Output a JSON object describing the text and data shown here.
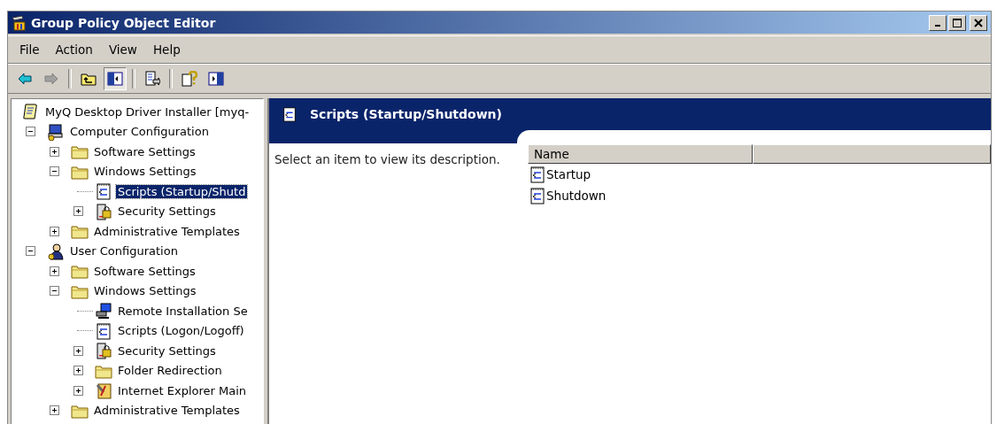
{
  "window": {
    "title": "Group Policy Object Editor"
  },
  "menu": [
    "File",
    "Action",
    "View",
    "Help"
  ],
  "toolbar": [
    {
      "kind": "back",
      "pressed": false
    },
    {
      "kind": "forward",
      "pressed": false
    },
    {
      "kind": "sep"
    },
    {
      "kind": "up",
      "pressed": false
    },
    {
      "kind": "tree",
      "pressed": true
    },
    {
      "kind": "sep"
    },
    {
      "kind": "export",
      "pressed": false
    },
    {
      "kind": "sep"
    },
    {
      "kind": "help",
      "pressed": false
    },
    {
      "kind": "pane",
      "pressed": false
    }
  ],
  "tree": [
    {
      "label": "MyQ Desktop Driver Installer [myq-",
      "kind": "policy",
      "selected": false,
      "children": [
        {
          "label": "Computer Configuration",
          "kind": "computer",
          "expanded": true,
          "selected": false,
          "children": [
            {
              "label": "Software Settings",
              "kind": "folder",
              "expanded": false,
              "selected": false
            },
            {
              "label": "Windows Settings",
              "kind": "folder",
              "expanded": true,
              "selected": false,
              "children": [
                {
                  "label": "Scripts (Startup/Shutd",
                  "kind": "script",
                  "selected": true
                },
                {
                  "label": "Security Settings",
                  "kind": "security",
                  "expanded": false,
                  "selected": false
                }
              ]
            },
            {
              "label": "Administrative Templates",
              "kind": "folder",
              "expanded": false,
              "selected": false
            }
          ]
        },
        {
          "label": "User Configuration",
          "kind": "user",
          "expanded": true,
          "selected": false,
          "children": [
            {
              "label": "Software Settings",
              "kind": "folder",
              "expanded": false,
              "selected": false
            },
            {
              "label": "Windows Settings",
              "kind": "folder",
              "expanded": true,
              "selected": false,
              "children": [
                {
                  "label": "Remote Installation Se",
                  "kind": "remote",
                  "selected": false
                },
                {
                  "label": "Scripts (Logon/Logoff)",
                  "kind": "script",
                  "selected": false
                },
                {
                  "label": "Security Settings",
                  "kind": "security",
                  "expanded": false,
                  "selected": false
                },
                {
                  "label": "Folder Redirection",
                  "kind": "folder",
                  "expanded": false,
                  "selected": false
                },
                {
                  "label": "Internet Explorer Main",
                  "kind": "ie",
                  "expanded": false,
                  "selected": false
                }
              ]
            },
            {
              "label": "Administrative Templates",
              "kind": "folder",
              "expanded": false,
              "selected": false
            }
          ]
        }
      ]
    }
  ],
  "details": {
    "title": "Scripts (Startup/Shutdown)",
    "description": "Select an item to view its description.",
    "columns": [
      "Name"
    ],
    "items": [
      {
        "name": "Startup"
      },
      {
        "name": "Shutdown"
      }
    ]
  }
}
